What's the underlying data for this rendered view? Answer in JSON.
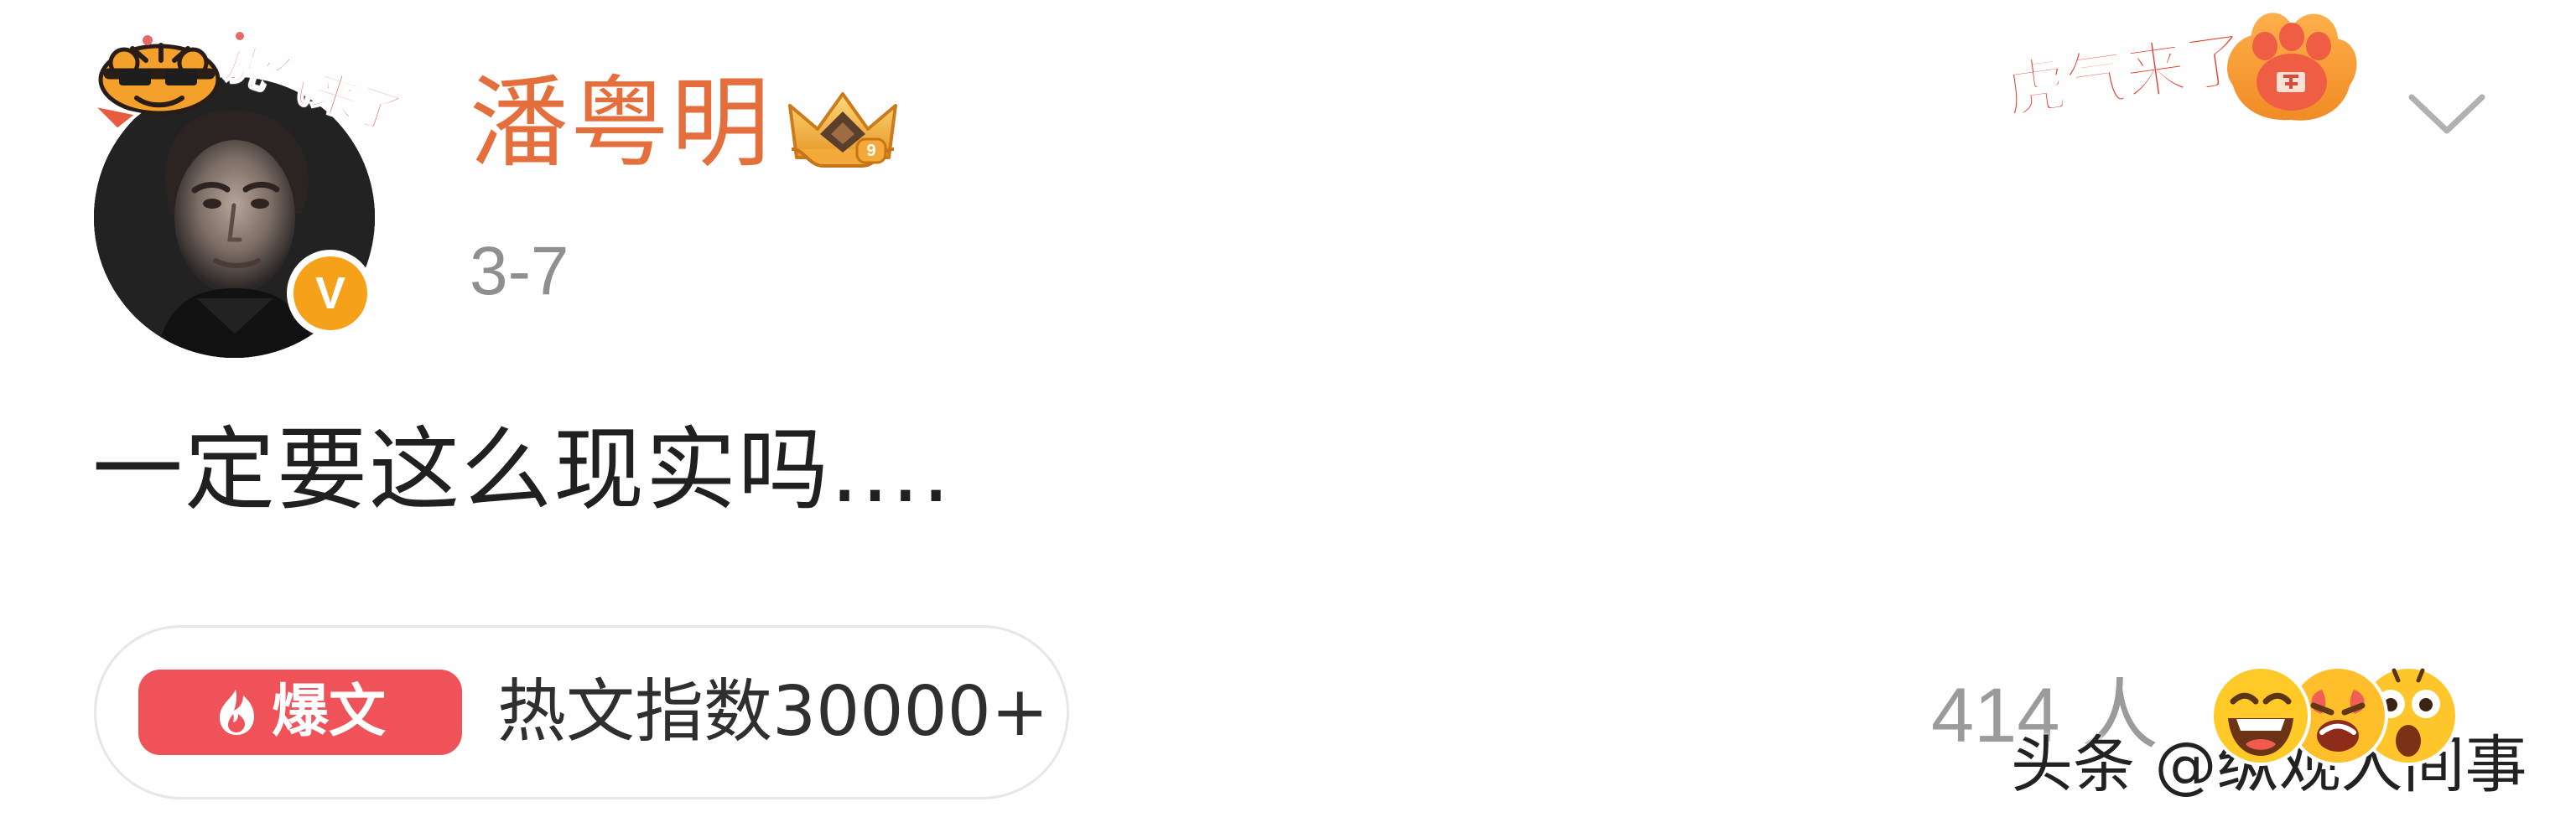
{
  "post": {
    "username": "潘粤明",
    "date": "3-7",
    "text": "一定要这么现实吗....",
    "hot_tag_label": "爆文",
    "hot_index_text": "热文指数30000+",
    "reaction_count": "414 人",
    "watermark": "头条 @纵观人间事",
    "left_sticker_text": "虎气来了",
    "right_sticker_text": "虎气来了",
    "verified_badge_text": "V"
  },
  "icons": {
    "avatar": "avatar",
    "tiger": "tiger-icon",
    "crown": "crown-icon",
    "paw": "paw-icon",
    "dropdown": "chevron-down-icon",
    "fire": "fire-icon",
    "laugh": "laughing-emoji-icon",
    "angry": "angry-emoji-icon",
    "surprised": "surprised-emoji-icon"
  },
  "colors": {
    "username": "#e46f3c",
    "verified": "#f5a11a",
    "hot_tag": "#ef5359",
    "date": "#8f8f8f",
    "reaction_count": "#9b9b9b"
  }
}
